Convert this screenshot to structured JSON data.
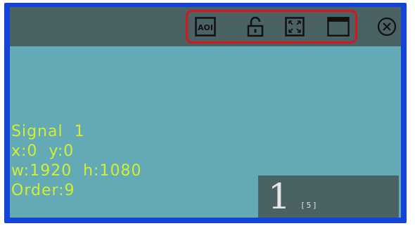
{
  "toolbar": {
    "icons": [
      "aoi-icon",
      "unlock-icon",
      "fullscreen-icon",
      "window-icon",
      "close-icon"
    ],
    "aoi_label": "AOI",
    "highlight_color": "#d8141e"
  },
  "window": {
    "signal_name": "Signal  1",
    "position": "x:0  y:0",
    "size": "w:1920  h:1080",
    "order": "Order:9",
    "id_number": "1",
    "id_sub": "[5]",
    "text_color": "#d2ee34",
    "background_color": "#64aab6",
    "border_color": "#1443d8"
  }
}
